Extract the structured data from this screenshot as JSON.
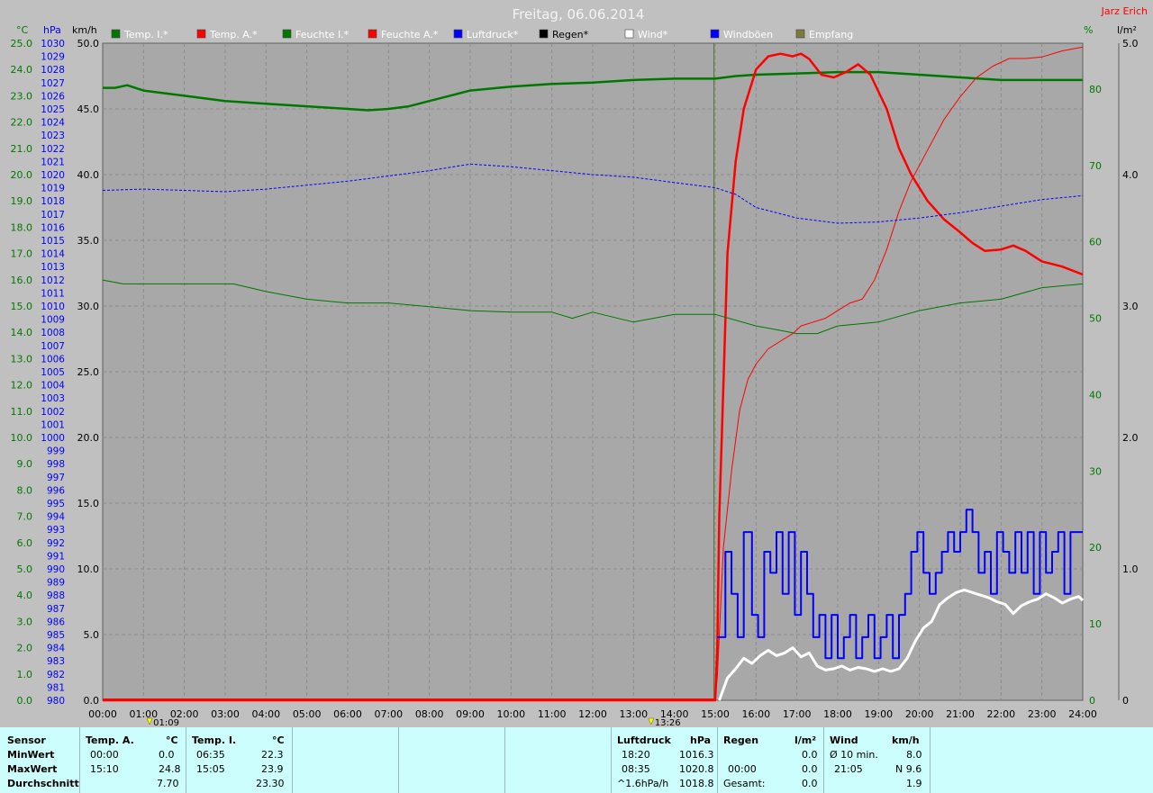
{
  "page": {
    "title": "Freitag, 06.06.2014",
    "author": "Jarz Erich"
  },
  "colors": {
    "background": "#c0c0c0",
    "plot_bg": "#a8a8a8",
    "grid": "#8c8c8c",
    "temp_green": "#007800",
    "red": "#ff0000",
    "blue": "#0000ff",
    "white": "#ffffff",
    "stats_bg": "#ccfefe"
  },
  "axis_units": {
    "celsius": "°C",
    "hpa": "hPa",
    "kmh": "km/h",
    "percent": "%",
    "rain": "l/m²"
  },
  "legend": [
    {
      "label": "Temp. I.*",
      "color": "#007800",
      "text_color": "#ffffff"
    },
    {
      "label": "Temp. A.*",
      "color": "#ff0000",
      "text_color": "#ffffff"
    },
    {
      "label": "Feuchte I.*",
      "color": "#007800",
      "text_color": "#ffffff"
    },
    {
      "label": "Feuchte A.*",
      "color": "#ff0000",
      "text_color": "#ffffff"
    },
    {
      "label": "Luftdruck*",
      "color": "#0000ff",
      "text_color": "#ffffff"
    },
    {
      "label": "Regen*",
      "color": "#000000",
      "text_color": "#000000"
    },
    {
      "label": "Wind*",
      "color": "#ffffff",
      "text_color": "#ffffff"
    },
    {
      "label": "Windböen",
      "color": "#0000ff",
      "text_color": "#ffffff"
    },
    {
      "label": "Empfang",
      "color": "#7b7b3b",
      "text_color": "#ffffff"
    }
  ],
  "markers": [
    {
      "label": "01:09",
      "x": 1.15
    },
    {
      "label": "13:26",
      "x": 13.43
    }
  ],
  "chart_data": {
    "type": "line",
    "title": "Freitag, 06.06.2014",
    "x_unit": "hours",
    "x_range": [
      0,
      24
    ],
    "x_ticks": [
      "00:00",
      "01:00",
      "02:00",
      "03:00",
      "04:00",
      "05:00",
      "06:00",
      "07:00",
      "08:00",
      "09:00",
      "10:00",
      "11:00",
      "12:00",
      "13:00",
      "14:00",
      "15:00",
      "16:00",
      "17:00",
      "18:00",
      "19:00",
      "20:00",
      "21:00",
      "22:00",
      "23:00",
      "24:00"
    ],
    "axes": {
      "celsius": {
        "range": [
          0,
          25
        ],
        "ticks": [
          "0.0",
          "1.0",
          "2.0",
          "3.0",
          "4.0",
          "5.0",
          "6.0",
          "7.0",
          "8.0",
          "9.0",
          "10.0",
          "11.0",
          "12.0",
          "13.0",
          "14.0",
          "15.0",
          "16.0",
          "17.0",
          "18.0",
          "19.0",
          "20.0",
          "21.0",
          "22.0",
          "23.0",
          "24.0",
          "25.0"
        ]
      },
      "hpa": {
        "range": [
          980,
          1030
        ],
        "ticks": [
          "980",
          "981",
          "982",
          "983",
          "984",
          "985",
          "986",
          "987",
          "988",
          "989",
          "990",
          "991",
          "992",
          "993",
          "994",
          "995",
          "996",
          "997",
          "998",
          "999",
          "1000",
          "1001",
          "1002",
          "1003",
          "1004",
          "1005",
          "1006",
          "1007",
          "1008",
          "1009",
          "1010",
          "1011",
          "1012",
          "1013",
          "1014",
          "1015",
          "1016",
          "1017",
          "1018",
          "1019",
          "1020",
          "1021",
          "1022",
          "1023",
          "1024",
          "1025",
          "1026",
          "1027",
          "1028",
          "1029",
          "1030"
        ]
      },
      "kmh": {
        "range": [
          0,
          50
        ],
        "ticks": [
          "0.0",
          "5.0",
          "10.0",
          "15.0",
          "20.0",
          "25.0",
          "30.0",
          "35.0",
          "40.0",
          "45.0",
          "50.0"
        ]
      },
      "percent": {
        "range": [
          0,
          86
        ],
        "ticks": [
          "0",
          "10",
          "20",
          "30",
          "40",
          "50",
          "60",
          "70",
          "80"
        ]
      },
      "rain": {
        "range": [
          0,
          5
        ],
        "ticks": [
          "0",
          "1.0",
          "2.0",
          "3.0",
          "4.0",
          "5.0"
        ]
      }
    },
    "grid": true,
    "series": [
      {
        "name": "Temp. I.*",
        "axis": "celsius",
        "color": "#007800",
        "width": 2.5,
        "x": [
          0,
          0.3,
          0.6,
          1,
          1.5,
          2,
          3,
          4,
          5,
          6,
          6.5,
          7,
          7.5,
          8,
          8.5,
          9,
          10,
          11,
          12,
          13,
          14,
          15,
          15.5,
          16,
          17,
          18,
          19,
          20,
          21,
          22,
          23,
          24
        ],
        "y": [
          23.3,
          23.3,
          23.4,
          23.2,
          23.1,
          23.0,
          22.8,
          22.7,
          22.6,
          22.5,
          22.45,
          22.5,
          22.6,
          22.8,
          23.0,
          23.2,
          23.35,
          23.45,
          23.5,
          23.6,
          23.65,
          23.65,
          23.75,
          23.8,
          23.85,
          23.9,
          23.9,
          23.8,
          23.7,
          23.6,
          23.6,
          23.6
        ]
      },
      {
        "name": "Temp. A.*",
        "axis": "celsius",
        "color": "#ff0000",
        "width": 2.5,
        "x": [
          0,
          15,
          15.05,
          15.1,
          15.2,
          15.3,
          15.5,
          15.7,
          16,
          16.3,
          16.6,
          16.9,
          17.1,
          17.3,
          17.6,
          17.9,
          18.2,
          18.5,
          18.8,
          19.2,
          19.5,
          19.8,
          20.2,
          20.6,
          21,
          21.3,
          21.6,
          22,
          22.3,
          22.6,
          23,
          23.5,
          24
        ],
        "y": [
          0,
          0,
          2,
          7,
          12,
          17,
          20.5,
          22.5,
          24.0,
          24.5,
          24.6,
          24.5,
          24.6,
          24.4,
          23.8,
          23.7,
          23.9,
          24.2,
          23.8,
          22.5,
          21.0,
          20.0,
          19.0,
          18.3,
          17.8,
          17.4,
          17.1,
          17.15,
          17.3,
          17.1,
          16.7,
          16.5,
          16.2
        ]
      },
      {
        "name": "Feuchte I.*",
        "axis": "percent",
        "color": "#007800",
        "width": 1,
        "x": [
          0,
          0.5,
          2,
          3.2,
          4,
          5,
          6,
          7,
          8,
          9,
          10,
          11,
          11.5,
          12,
          13,
          14,
          15,
          16,
          16.5,
          17,
          17.5,
          18,
          19,
          20,
          21,
          22,
          23,
          24
        ],
        "y": [
          55,
          54.5,
          54.5,
          54.5,
          53.5,
          52.5,
          52,
          52,
          51.5,
          51,
          50.8,
          50.8,
          50,
          50.8,
          49.5,
          50.5,
          50.5,
          49,
          48.5,
          48,
          48,
          49,
          49.5,
          51,
          52,
          52.5,
          54,
          54.5
        ]
      },
      {
        "name": "Feuchte A.*",
        "axis": "percent",
        "color": "#ff0000",
        "width": 1,
        "x": [
          0,
          15,
          15.05,
          15.2,
          15.4,
          15.6,
          15.8,
          16,
          16.3,
          16.6,
          16.9,
          17.1,
          17.4,
          17.7,
          18,
          18.3,
          18.6,
          18.9,
          19.2,
          19.5,
          19.8,
          20.2,
          20.6,
          21,
          21.4,
          21.8,
          22.2,
          22.6,
          23,
          23.5,
          24
        ],
        "y": [
          0,
          0,
          3,
          20,
          30,
          38,
          42,
          44,
          46,
          47,
          48,
          49,
          49.5,
          50,
          51,
          52,
          52.5,
          55,
          59,
          64,
          68,
          72,
          76,
          79,
          81.5,
          83,
          84,
          84,
          84.2,
          85,
          85.5
        ]
      },
      {
        "name": "Luftdruck*",
        "axis": "hpa",
        "color": "#0000ff",
        "width": 1,
        "dash": true,
        "x": [
          0,
          1,
          2,
          3,
          4,
          5,
          6,
          7,
          8,
          9,
          10,
          11,
          12,
          13,
          14,
          15,
          15.5,
          16,
          17,
          18,
          19,
          20,
          21,
          22,
          23,
          24
        ],
        "y": [
          1018.8,
          1018.9,
          1018.8,
          1018.7,
          1018.9,
          1019.2,
          1019.5,
          1019.9,
          1020.3,
          1020.8,
          1020.6,
          1020.3,
          1020.0,
          1019.8,
          1019.4,
          1019.0,
          1018.5,
          1017.5,
          1016.7,
          1016.3,
          1016.4,
          1016.7,
          1017.1,
          1017.6,
          1018.1,
          1018.4
        ]
      },
      {
        "name": "Wind*",
        "axis": "kmh",
        "color": "#ffffff",
        "width": 3,
        "x": [
          0,
          15.1,
          15.3,
          15.5,
          15.7,
          15.9,
          16.1,
          16.3,
          16.5,
          16.7,
          16.9,
          17.1,
          17.3,
          17.5,
          17.7,
          17.9,
          18.1,
          18.3,
          18.5,
          18.7,
          18.9,
          19.1,
          19.3,
          19.5,
          19.7,
          19.9,
          20.1,
          20.3,
          20.5,
          20.7,
          20.9,
          21.1,
          21.3,
          21.5,
          21.7,
          21.9,
          22.1,
          22.3,
          22.5,
          22.7,
          22.9,
          23.1,
          23.3,
          23.5,
          23.7,
          23.9,
          24
        ],
        "y": [
          null,
          0,
          1.7,
          2.4,
          3.2,
          2.8,
          3.4,
          3.8,
          3.4,
          3.6,
          4.0,
          3.3,
          3.6,
          2.6,
          2.3,
          2.4,
          2.6,
          2.3,
          2.5,
          2.4,
          2.2,
          2.4,
          2.2,
          2.4,
          3.2,
          4.5,
          5.5,
          6.0,
          7.3,
          7.8,
          8.2,
          8.4,
          8.2,
          8.0,
          7.8,
          7.5,
          7.3,
          6.6,
          7.2,
          7.5,
          7.7,
          8.1,
          7.8,
          7.4,
          7.7,
          7.9,
          7.6
        ]
      },
      {
        "name": "Windböen",
        "axis": "kmh",
        "color": "#0000ff",
        "width": 2,
        "step": true,
        "x": [
          0,
          15.05,
          15.25,
          15.4,
          15.55,
          15.7,
          15.9,
          16.05,
          16.2,
          16.35,
          16.5,
          16.65,
          16.8,
          16.95,
          17.1,
          17.25,
          17.4,
          17.55,
          17.7,
          17.85,
          18.0,
          18.15,
          18.3,
          18.45,
          18.6,
          18.75,
          18.9,
          19.05,
          19.2,
          19.35,
          19.5,
          19.65,
          19.8,
          19.95,
          20.1,
          20.25,
          20.4,
          20.55,
          20.7,
          20.85,
          21.0,
          21.15,
          21.3,
          21.45,
          21.6,
          21.75,
          21.9,
          22.05,
          22.2,
          22.35,
          22.5,
          22.65,
          22.8,
          22.95,
          23.1,
          23.25,
          23.4,
          23.55,
          23.7,
          23.85,
          24
        ],
        "y": [
          null,
          4.8,
          11.3,
          8.1,
          4.8,
          12.8,
          6.5,
          4.8,
          11.3,
          9.7,
          12.8,
          8.1,
          12.8,
          6.5,
          11.3,
          8.1,
          4.8,
          6.5,
          3.2,
          6.5,
          3.2,
          4.8,
          6.5,
          3.2,
          4.8,
          6.5,
          3.2,
          4.8,
          6.5,
          3.2,
          6.5,
          8.1,
          11.3,
          12.8,
          9.7,
          8.1,
          9.7,
          11.3,
          12.8,
          11.3,
          12.8,
          14.5,
          12.8,
          9.7,
          11.3,
          8.1,
          12.8,
          11.3,
          9.7,
          12.8,
          9.7,
          12.8,
          8.1,
          12.8,
          9.7,
          11.3,
          12.8,
          8.1,
          12.8,
          12.8,
          12.8
        ]
      }
    ]
  },
  "stats": {
    "sensor_header": "Sensor",
    "row_labels": [
      "MinWert",
      "MaxWert",
      "Durchschnitt"
    ],
    "temp_a": {
      "header": "Temp. A.",
      "unit": "°C",
      "rows": [
        [
          "00:00",
          "0.0"
        ],
        [
          "15:10",
          "24.8"
        ],
        [
          "",
          "7.70"
        ]
      ]
    },
    "temp_i": {
      "header": "Temp. I.",
      "unit": "°C",
      "rows": [
        [
          "06:35",
          "22.3"
        ],
        [
          "15:05",
          "23.9"
        ],
        [
          "",
          "23.30"
        ]
      ]
    },
    "luftdruck": {
      "header": "Luftdruck",
      "unit": "hPa",
      "rows": [
        [
          "18:20",
          "1016.3"
        ],
        [
          "08:35",
          "1020.8"
        ],
        [
          "^1.6hPa/h",
          "1018.8"
        ]
      ]
    },
    "regen": {
      "header": "Regen",
      "unit": "l/m²",
      "rows": [
        [
          "",
          ""
        ],
        [
          "00:00",
          "0.0"
        ],
        [
          "Gesamt:",
          "0.0"
        ]
      ],
      "row0_value": "0.0"
    },
    "wind": {
      "header": "Wind",
      "unit": "km/h",
      "rows": [
        [
          "Ø 10 min.",
          "8.0"
        ],
        [
          "21:05",
          "N 9.6"
        ],
        [
          "",
          "1.9"
        ]
      ]
    }
  }
}
